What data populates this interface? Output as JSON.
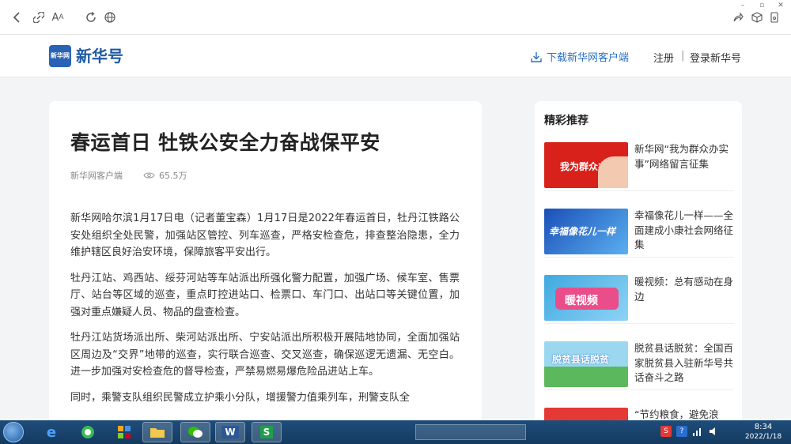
{
  "site": {
    "logo_small": "新华网",
    "logo_text": "新华号",
    "download_label": "下载新华网客户端",
    "register_label": "注册",
    "separator": "|",
    "login_label": "登录新华号"
  },
  "article": {
    "title": "春运首日 牡铁公安全力奋战保平安",
    "source": "新华网客户端",
    "views": "65.5万",
    "paragraphs": [
      "新华网哈尔滨1月17日电（记者董宝森）1月17日是2022年春运首日，牡丹江铁路公安处组织全处民警，加强站区管控、列车巡查，严格安检查危，排查整治隐患，全力维护辖区良好治安环境，保障旅客平安出行。",
      "牡丹江站、鸡西站、绥芬河站等车站派出所强化警力配置，加强广场、候车室、售票厅、站台等区域的巡查，重点盯控进站口、检票口、车门口、出站口等关键位置，加强对重点嫌疑人员、物品的盘查检查。",
      "牡丹江站货场派出所、柴河站派出所、宁安站派出所积极开展陆地协同，全面加强站区周边及“交界”地带的巡查，实行联合巡查、交叉巡查，确保巡逻无遗漏、无空白。进一步加强对安检查危的督导检查，严禁易燃易爆危险品进站上车。",
      "同时，乘警支队组织民警成立护乘小分队，增援警力值乘列车，刑警支队全"
    ]
  },
  "sidebar": {
    "title": "精彩推荐",
    "items": [
      {
        "text": "新华网“我为群众办实事”网络留言征集",
        "thumb_text": "我为群众办实事",
        "thumb_color": "#d8211b"
      },
      {
        "text": "幸福像花儿一样——全面建成小康社会网络征集",
        "thumb_text": "幸福像花儿一样",
        "thumb_color": "#2a6fd0"
      },
      {
        "text": "暖视频：总有感动在身边",
        "thumb_text": "暖视频",
        "thumb_color": "#3fa9e0"
      },
      {
        "text": "脱贫县话脱贫：全国百家脱贫县入驻新华号共话奋斗之路",
        "thumb_text": "脱贫县话脱贫",
        "thumb_color": "#4caf50"
      },
      {
        "text": "“节约粮食，避免浪",
        "thumb_text": "",
        "thumb_color": "#e53935"
      }
    ]
  },
  "taskbar": {
    "time": "8:34",
    "date": "2022/1/18"
  }
}
